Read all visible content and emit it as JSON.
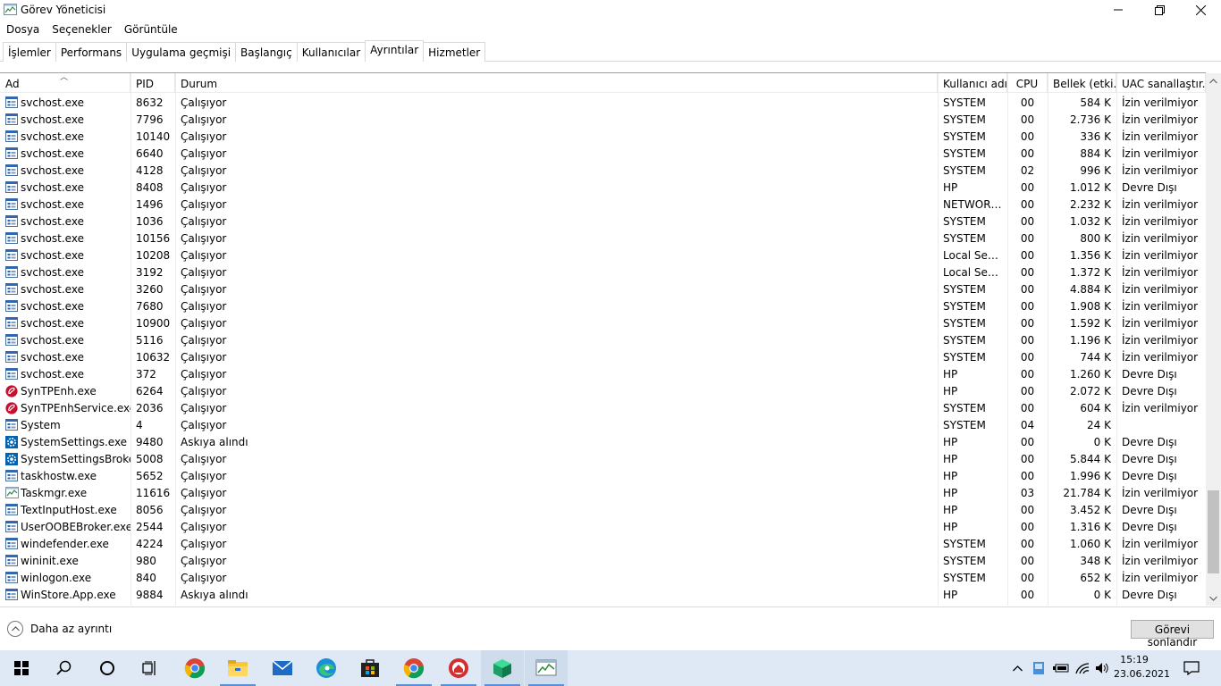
{
  "window": {
    "title": "Görev Yöneticisi"
  },
  "menu": [
    "Dosya",
    "Seçenekler",
    "Görüntüle"
  ],
  "tabs": [
    "İşlemler",
    "Performans",
    "Uygulama geçmişi",
    "Başlangıç",
    "Kullanıcılar",
    "Ayrıntılar",
    "Hizmetler"
  ],
  "active_tab": "Ayrıntılar",
  "columns": {
    "name": "Ad",
    "pid": "PID",
    "status": "Durum",
    "user": "Kullanıcı adı",
    "cpu": "CPU",
    "memory": "Bellek (etki...",
    "uac": "UAC sanallaştır..."
  },
  "rows": [
    {
      "name": "svchost.exe",
      "icon": "service-icon",
      "pid": "8632",
      "status": "Çalışıyor",
      "user": "SYSTEM",
      "cpu": "00",
      "mem": "584 K",
      "uac": "İzin verilmiyor"
    },
    {
      "name": "svchost.exe",
      "icon": "service-icon",
      "pid": "7796",
      "status": "Çalışıyor",
      "user": "SYSTEM",
      "cpu": "00",
      "mem": "2.736 K",
      "uac": "İzin verilmiyor"
    },
    {
      "name": "svchost.exe",
      "icon": "service-icon",
      "pid": "10140",
      "status": "Çalışıyor",
      "user": "SYSTEM",
      "cpu": "00",
      "mem": "336 K",
      "uac": "İzin verilmiyor"
    },
    {
      "name": "svchost.exe",
      "icon": "service-icon",
      "pid": "6640",
      "status": "Çalışıyor",
      "user": "SYSTEM",
      "cpu": "00",
      "mem": "884 K",
      "uac": "İzin verilmiyor"
    },
    {
      "name": "svchost.exe",
      "icon": "service-icon",
      "pid": "4128",
      "status": "Çalışıyor",
      "user": "SYSTEM",
      "cpu": "02",
      "mem": "996 K",
      "uac": "İzin verilmiyor"
    },
    {
      "name": "svchost.exe",
      "icon": "service-icon",
      "pid": "8408",
      "status": "Çalışıyor",
      "user": "HP",
      "cpu": "00",
      "mem": "1.012 K",
      "uac": "Devre Dışı"
    },
    {
      "name": "svchost.exe",
      "icon": "service-icon",
      "pid": "1496",
      "status": "Çalışıyor",
      "user": "NETWORK...",
      "cpu": "00",
      "mem": "2.232 K",
      "uac": "İzin verilmiyor"
    },
    {
      "name": "svchost.exe",
      "icon": "service-icon",
      "pid": "1036",
      "status": "Çalışıyor",
      "user": "SYSTEM",
      "cpu": "00",
      "mem": "1.032 K",
      "uac": "İzin verilmiyor"
    },
    {
      "name": "svchost.exe",
      "icon": "service-icon",
      "pid": "10156",
      "status": "Çalışıyor",
      "user": "SYSTEM",
      "cpu": "00",
      "mem": "800 K",
      "uac": "İzin verilmiyor"
    },
    {
      "name": "svchost.exe",
      "icon": "service-icon",
      "pid": "10208",
      "status": "Çalışıyor",
      "user": "Local Servi...",
      "cpu": "00",
      "mem": "1.356 K",
      "uac": "İzin verilmiyor"
    },
    {
      "name": "svchost.exe",
      "icon": "service-icon",
      "pid": "3192",
      "status": "Çalışıyor",
      "user": "Local Servi...",
      "cpu": "00",
      "mem": "1.372 K",
      "uac": "İzin verilmiyor"
    },
    {
      "name": "svchost.exe",
      "icon": "service-icon",
      "pid": "3260",
      "status": "Çalışıyor",
      "user": "SYSTEM",
      "cpu": "00",
      "mem": "4.884 K",
      "uac": "İzin verilmiyor"
    },
    {
      "name": "svchost.exe",
      "icon": "service-icon",
      "pid": "7680",
      "status": "Çalışıyor",
      "user": "SYSTEM",
      "cpu": "00",
      "mem": "1.908 K",
      "uac": "İzin verilmiyor"
    },
    {
      "name": "svchost.exe",
      "icon": "service-icon",
      "pid": "10900",
      "status": "Çalışıyor",
      "user": "SYSTEM",
      "cpu": "00",
      "mem": "1.592 K",
      "uac": "İzin verilmiyor"
    },
    {
      "name": "svchost.exe",
      "icon": "service-icon",
      "pid": "5116",
      "status": "Çalışıyor",
      "user": "SYSTEM",
      "cpu": "00",
      "mem": "1.196 K",
      "uac": "İzin verilmiyor"
    },
    {
      "name": "svchost.exe",
      "icon": "service-icon",
      "pid": "10632",
      "status": "Çalışıyor",
      "user": "SYSTEM",
      "cpu": "00",
      "mem": "744 K",
      "uac": "İzin verilmiyor"
    },
    {
      "name": "svchost.exe",
      "icon": "service-icon",
      "pid": "372",
      "status": "Çalışıyor",
      "user": "HP",
      "cpu": "00",
      "mem": "1.260 K",
      "uac": "Devre Dışı"
    },
    {
      "name": "SynTPEnh.exe",
      "icon": "synaptics-icon",
      "pid": "6264",
      "status": "Çalışıyor",
      "user": "HP",
      "cpu": "00",
      "mem": "2.072 K",
      "uac": "Devre Dışı"
    },
    {
      "name": "SynTPEnhService.exe",
      "icon": "synaptics-icon",
      "pid": "2036",
      "status": "Çalışıyor",
      "user": "SYSTEM",
      "cpu": "00",
      "mem": "604 K",
      "uac": "İzin verilmiyor"
    },
    {
      "name": "System",
      "icon": "service-icon",
      "pid": "4",
      "status": "Çalışıyor",
      "user": "SYSTEM",
      "cpu": "04",
      "mem": "24 K",
      "uac": ""
    },
    {
      "name": "SystemSettings.exe",
      "icon": "settings-gear-icon",
      "pid": "9480",
      "status": "Askıya alındı",
      "user": "HP",
      "cpu": "00",
      "mem": "0 K",
      "uac": "Devre Dışı"
    },
    {
      "name": "SystemSettingsBroke...",
      "icon": "settings-gear-icon",
      "pid": "5008",
      "status": "Çalışıyor",
      "user": "HP",
      "cpu": "00",
      "mem": "5.844 K",
      "uac": "Devre Dışı"
    },
    {
      "name": "taskhostw.exe",
      "icon": "service-icon",
      "pid": "5652",
      "status": "Çalışıyor",
      "user": "HP",
      "cpu": "00",
      "mem": "1.996 K",
      "uac": "Devre Dışı"
    },
    {
      "name": "Taskmgr.exe",
      "icon": "task-manager-icon",
      "pid": "11616",
      "status": "Çalışıyor",
      "user": "HP",
      "cpu": "03",
      "mem": "21.784 K",
      "uac": "İzin verilmiyor"
    },
    {
      "name": "TextInputHost.exe",
      "icon": "service-icon",
      "pid": "8056",
      "status": "Çalışıyor",
      "user": "HP",
      "cpu": "00",
      "mem": "3.452 K",
      "uac": "Devre Dışı"
    },
    {
      "name": "UserOOBEBroker.exe",
      "icon": "service-icon",
      "pid": "2544",
      "status": "Çalışıyor",
      "user": "HP",
      "cpu": "00",
      "mem": "1.316 K",
      "uac": "Devre Dışı"
    },
    {
      "name": "windefender.exe",
      "icon": "service-icon",
      "pid": "4224",
      "status": "Çalışıyor",
      "user": "SYSTEM",
      "cpu": "00",
      "mem": "1.060 K",
      "uac": "İzin verilmiyor"
    },
    {
      "name": "wininit.exe",
      "icon": "service-icon",
      "pid": "980",
      "status": "Çalışıyor",
      "user": "SYSTEM",
      "cpu": "00",
      "mem": "348 K",
      "uac": "İzin verilmiyor"
    },
    {
      "name": "winlogon.exe",
      "icon": "service-icon",
      "pid": "840",
      "status": "Çalışıyor",
      "user": "SYSTEM",
      "cpu": "00",
      "mem": "652 K",
      "uac": "İzin verilmiyor"
    },
    {
      "name": "WinStore.App.exe",
      "icon": "service-icon",
      "pid": "9884",
      "status": "Askıya alındı",
      "user": "HP",
      "cpu": "00",
      "mem": "0 K",
      "uac": "Devre Dışı"
    }
  ],
  "footer": {
    "less_details": "Daha az ayrıntı",
    "end_task": "Görevi sonlandır"
  },
  "taskbar": {
    "apps": [
      "start-icon",
      "search-icon",
      "cortana-icon",
      "task-view-icon",
      "chrome-icon",
      "file-explorer-icon",
      "mail-icon",
      "edge-icon",
      "store-icon",
      "chrome-icon",
      "app-red-icon",
      "app-green-cube-icon",
      "task-manager-icon"
    ],
    "time": "15:19",
    "date": "23.06.2021"
  },
  "colors": {
    "taskbar": "#dee9f5",
    "accent": "#0078d7",
    "synaptics": "#c8102e"
  }
}
